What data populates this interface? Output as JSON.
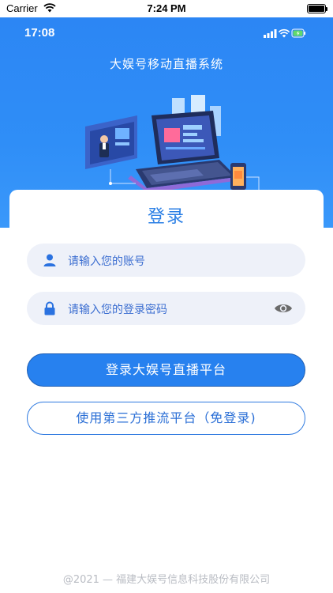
{
  "system_bar": {
    "carrier": "Carrier",
    "time": "7:24 PM"
  },
  "app_bar": {
    "time": "17:08"
  },
  "header": {
    "title": "大娱号移动直播系统"
  },
  "login": {
    "title": "登录",
    "account_placeholder": "请输入您的账号",
    "password_placeholder": "请输入您的登录密码",
    "primary_button": "登录大娱号直播平台",
    "secondary_button": "使用第三方推流平台（免登录)"
  },
  "footer": {
    "copyright": "@2021 — 福建大娱号信息科技股份有限公司"
  },
  "colors": {
    "header_blue": "#2f8ef7",
    "accent_blue": "#2781ef",
    "field_bg": "#eef1f9"
  }
}
